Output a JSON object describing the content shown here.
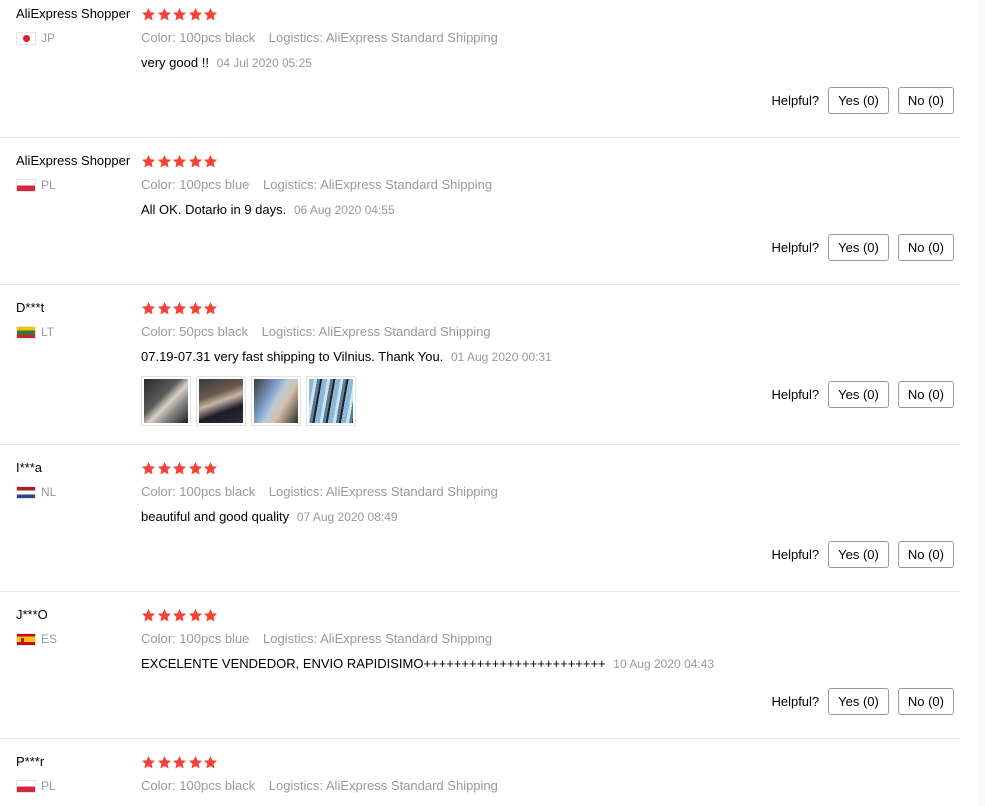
{
  "helpful_label": "Helpful?",
  "colors": {
    "star": "#f44336",
    "meta_text": "#999999",
    "divider": "#e8e8e8"
  },
  "feedbacks": [
    {
      "user": "AliExpress Shopper",
      "country": "JP",
      "flag_icon": "flag-japan-icon",
      "rating": 5,
      "color": "Color: 100pcs black",
      "logistics": "Logistics: AliExpress Standard Shipping",
      "text": "very good !!",
      "date": "04 Jul 2020 05:25",
      "yes": "Yes (0)",
      "no": "No (0)"
    },
    {
      "user": "AliExpress Shopper",
      "country": "PL",
      "flag_icon": "flag-poland-icon",
      "rating": 5,
      "color": "Color: 100pcs blue",
      "logistics": "Logistics: AliExpress Standard Shipping",
      "text": "All OK. Dotarło in 9 days.",
      "date": "06 Aug 2020 04:55",
      "yes": "Yes (0)",
      "no": "No (0)"
    },
    {
      "user": "D***t",
      "country": "LT",
      "flag_icon": "flag-lithuania-icon",
      "rating": 5,
      "color": "Color: 50pcs black",
      "logistics": "Logistics: AliExpress Standard Shipping",
      "text": "07.19-07.31 very fast shipping to Vilnius. Thank You.",
      "date": "01 Aug 2020 00:31",
      "photos": [
        "review-photo-1",
        "review-photo-2",
        "review-photo-3",
        "review-photo-4"
      ],
      "yes": "Yes (0)",
      "no": "No (0)"
    },
    {
      "user": "I***a",
      "country": "NL",
      "flag_icon": "flag-netherlands-icon",
      "rating": 5,
      "color": "Color: 100pcs black",
      "logistics": "Logistics: AliExpress Standard Shipping",
      "text": "beautiful and good quality",
      "date": "07 Aug 2020 08:49",
      "yes": "Yes (0)",
      "no": "No (0)"
    },
    {
      "user": "J***O",
      "country": "ES",
      "flag_icon": "flag-spain-icon",
      "rating": 5,
      "color": "Color: 100pcs blue",
      "logistics": "Logistics: AliExpress Standard Shipping",
      "text": "EXCELENTE VENDEDOR, ENVIO RAPIDISIMO++++++++++++++++++++++++",
      "date": "10 Aug 2020 04:43",
      "yes": "Yes (0)",
      "no": "No (0)"
    },
    {
      "user": "P***r",
      "country": "PL",
      "flag_icon": "flag-poland-icon",
      "rating": 5,
      "color": "Color: 100pcs black",
      "logistics": "Logistics: AliExpress Standard Shipping"
    }
  ]
}
